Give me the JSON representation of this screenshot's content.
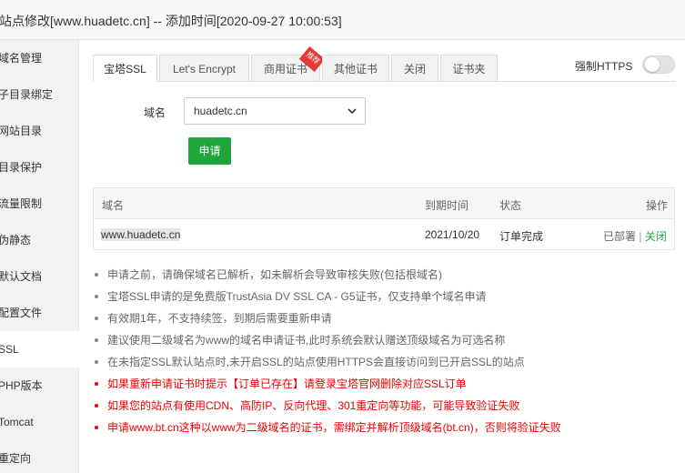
{
  "window": {
    "title": "站点修改[www.huadetc.cn] -- 添加时间[2020-09-27 10:00:53]"
  },
  "sidebar": {
    "items": [
      {
        "label": "域名管理"
      },
      {
        "label": "子目录绑定"
      },
      {
        "label": "网站目录"
      },
      {
        "label": "目录保护"
      },
      {
        "label": "流量限制"
      },
      {
        "label": "伪静态"
      },
      {
        "label": "默认文档"
      },
      {
        "label": "配置文件"
      },
      {
        "label": "SSL"
      },
      {
        "label": "PHP版本"
      },
      {
        "label": "Tomcat"
      },
      {
        "label": "重定向"
      }
    ],
    "active": "SSL"
  },
  "tabs": [
    {
      "label": "宝塔SSL"
    },
    {
      "label": "Let's Encrypt"
    },
    {
      "label": "商用证书"
    },
    {
      "label": "其他证书"
    },
    {
      "label": "关闭"
    },
    {
      "label": "证书夹"
    }
  ],
  "tab_badge": "推荐",
  "force_https": {
    "label": "强制HTTPS",
    "enabled": false
  },
  "form": {
    "domain_label": "域名",
    "domain_value": "huadetc.cn",
    "apply_label": "申请"
  },
  "table": {
    "headers": {
      "domain": "域名",
      "expire": "到期时间",
      "status": "状态",
      "action": "操作"
    },
    "rows": [
      {
        "domain": "www.huadetc.cn",
        "expire": "2021/10/20",
        "status": "订单完成",
        "deployed": "已部署",
        "separator": "|",
        "close": "关闭"
      }
    ]
  },
  "tips": [
    {
      "text": "申请之前，请确保域名已解析，如未解析会导致审核失败(包括根域名)",
      "color": "#666666"
    },
    {
      "text": "宝塔SSL申请的是免费版TrustAsia DV SSL CA - G5证书，仅支持单个域名申请",
      "color": "#666666"
    },
    {
      "text": "有效期1年，不支持续签，到期后需要重新申请",
      "color": "#666666"
    },
    {
      "text": "建议使用二级域名为www的域名申请证书,此时系统会默认赠送顶级域名为可选名称",
      "color": "#666666"
    },
    {
      "text": "在未指定SSL默认站点时,未开启SSL的站点使用HTTPS会直接访问到已开启SSL的站点",
      "color": "#666666"
    },
    {
      "text": "如果重新申请证书时提示【订单已存在】请登录宝塔官网删除对应SSL订单",
      "color": "#ee0000"
    },
    {
      "text": "如果您的站点有使用CDN、高防IP、反向代理、301重定向等功能，可能导致验证失败",
      "color": "#ee0000"
    },
    {
      "text": "申请www.bt.cn这种以www为二级域名的证书，需绑定并解析顶级域名(bt.cn)，否则将验证失败",
      "color": "#ee0000"
    }
  ],
  "colors": {
    "accent": "#20a53a",
    "warning": "#ee0000",
    "ribbon": "#e53935"
  }
}
